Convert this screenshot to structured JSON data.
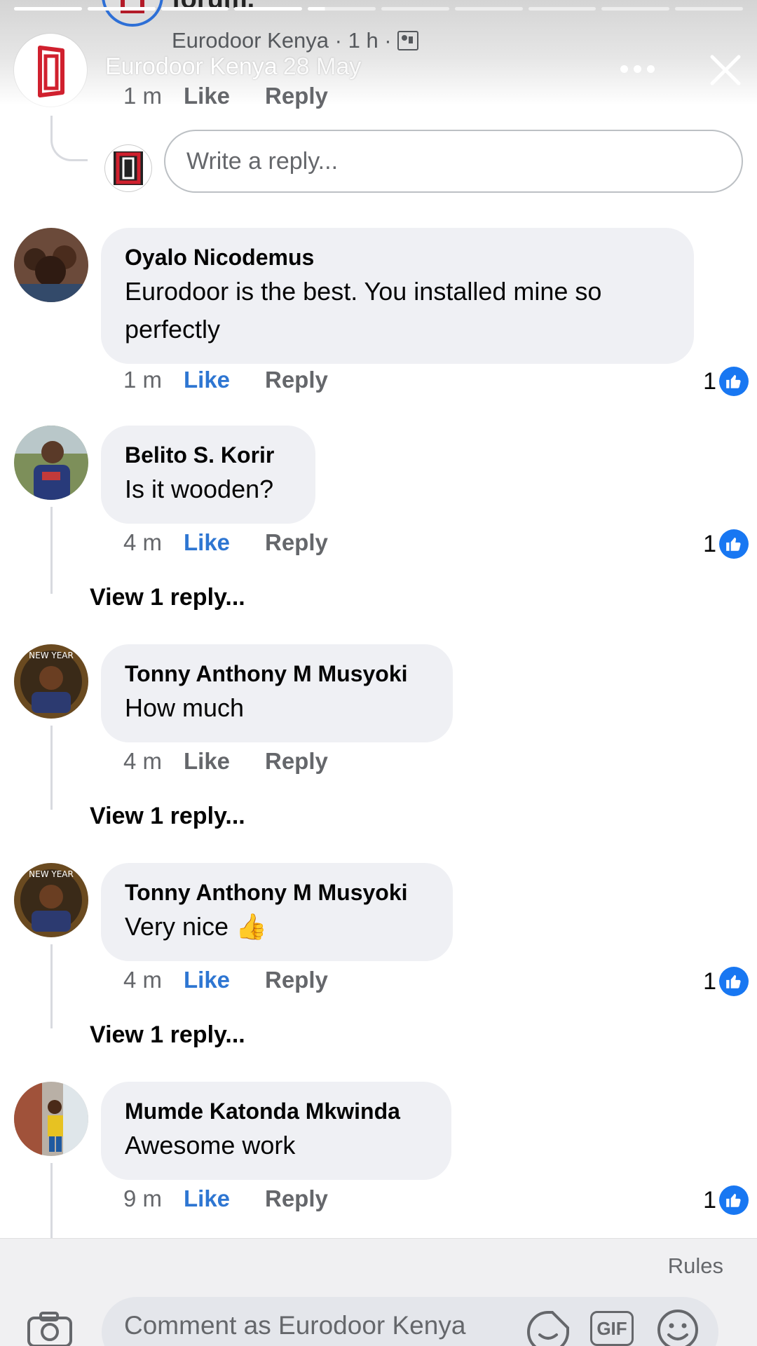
{
  "story_header": {
    "cut_title": "forum.",
    "page_name": "Eurodoor Kenya",
    "post_meta": "Eurodoor Kenya · 1 h ·",
    "story_name": "Eurodoor Kenya",
    "story_date": "28 May",
    "progress_segments": 10,
    "progress_done": 5
  },
  "page_reply": {
    "time": "1 m",
    "like_label": "Like",
    "reply_label": "Reply"
  },
  "write_reply": {
    "placeholder": "Write a reply..."
  },
  "comments": [
    {
      "author": "Oyalo Nicodemus",
      "text": "Eurodoor is the best. You installed mine so perfectly",
      "time": "1 m",
      "like_label": "Like",
      "reply_label": "Reply",
      "liked": true,
      "likes": "1",
      "view_replies": ""
    },
    {
      "author": "Belito S. Korir",
      "text": "Is it wooden?",
      "time": "4 m",
      "like_label": "Like",
      "reply_label": "Reply",
      "liked": true,
      "likes": "1",
      "view_replies": "View 1 reply..."
    },
    {
      "author": "Tonny Anthony M Musyoki",
      "text": "How much",
      "time": "4 m",
      "like_label": "Like",
      "reply_label": "Reply",
      "liked": false,
      "likes": "",
      "view_replies": "View 1 reply..."
    },
    {
      "author": "Tonny Anthony M Musyoki",
      "text": "Very nice 👍",
      "time": "4 m",
      "like_label": "Like",
      "reply_label": "Reply",
      "liked": true,
      "likes": "1",
      "view_replies": "View 1 reply..."
    },
    {
      "author": "Mumde Katonda Mkwinda",
      "text": "Awesome work",
      "time": "9 m",
      "like_label": "Like",
      "reply_label": "Reply",
      "liked": true,
      "likes": "1",
      "view_replies": ""
    }
  ],
  "footer": {
    "rules_label": "Rules",
    "comment_placeholder": "Comment as Eurodoor Kenya",
    "gif_label": "GIF"
  },
  "colors": {
    "like_blue": "#2e76d2",
    "reaction_blue": "#1877f2",
    "bubble_bg": "#eff0f4",
    "muted_text": "#65676b",
    "brand_red": "#d0202e"
  },
  "icons": [
    "more-icon",
    "close-icon",
    "thumbs-up-icon",
    "camera-icon",
    "sticker-icon",
    "gif-icon",
    "emoji-icon"
  ]
}
